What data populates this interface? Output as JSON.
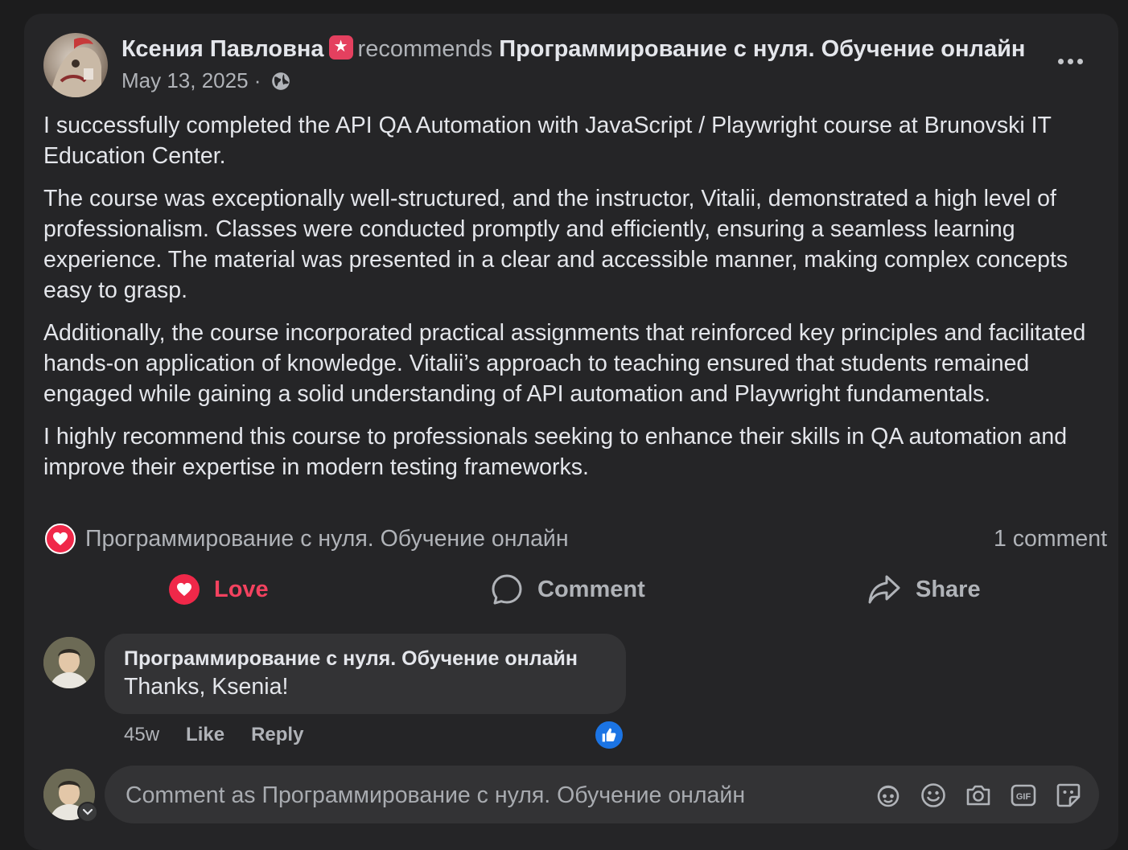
{
  "post": {
    "author": "Ксения Павловна",
    "recommends_word": "recommends",
    "page_name": "Программирование с нуля. Обучение онлайн",
    "date": "May 13, 2025",
    "date_separator": "·",
    "privacy_icon": "globe-icon",
    "badge_icon": "recommend-star-icon",
    "paragraphs": [
      "I successfully completed the API QA Automation with JavaScript / Playwright course at Brunovski IT Education Center.",
      "The course was exceptionally well-structured, and the instructor, Vitalii, demonstrated a high level of professionalism. Classes were conducted promptly and efficiently, ensuring a seamless learning experience. The material was presented in a clear and accessible manner, making complex concepts easy to grasp.",
      "Additionally, the course incorporated practical assignments that reinforced key principles and facilitated hands-on application of knowledge. Vitalii’s approach to teaching ensured that students remained engaged while gaining a solid understanding of API automation and Playwright fundamentals.",
      "I highly recommend this course to professionals seeking to enhance their skills in QA automation and improve their expertise in modern testing frameworks."
    ]
  },
  "reactions": {
    "names": "Программирование с нуля. Обучение онлайн",
    "comment_count": "1 comment"
  },
  "actions": {
    "love": "Love",
    "comment": "Comment",
    "share": "Share"
  },
  "comment": {
    "author": "Программирование с нуля. Обучение онлайн",
    "text": "Thanks, Ksenia!",
    "time": "45w",
    "like": "Like",
    "reply": "Reply"
  },
  "composer": {
    "placeholder": "Comment as Программирование с нуля. Обучение онлайн",
    "icons": [
      "avatar-sticker-icon",
      "emoji-icon",
      "camera-icon",
      "gif-icon",
      "sticker-icon"
    ]
  },
  "colors": {
    "background": "#1c1c1d",
    "card": "#252527",
    "love": "#f3425f",
    "like_blue": "#1b74e4"
  }
}
